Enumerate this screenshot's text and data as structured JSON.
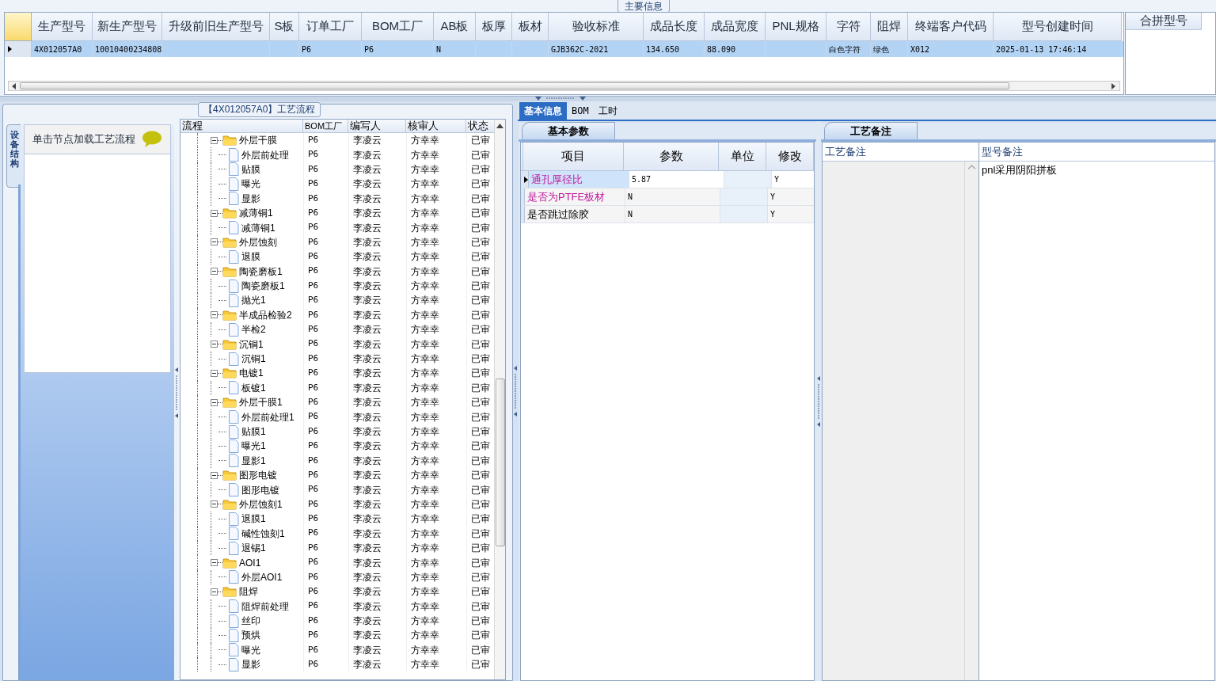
{
  "main_group": {
    "title": "主要信息"
  },
  "main_grid": {
    "columns": [
      "生产型号",
      "新生产型号",
      "升级前旧生产型号",
      "S板",
      "订单工厂",
      "BOM工厂",
      "AB板",
      "板厚",
      "板材",
      "验收标准",
      "成品长度",
      "成品宽度",
      "PNL规格",
      "字符",
      "阻焊",
      "终端客户代码",
      "型号创建时间"
    ],
    "rows": [
      {
        "selected": true,
        "cells": [
          "4X012057A0",
          "10010400234808",
          "",
          "",
          "P6",
          "P6",
          "N",
          "",
          "",
          "GJB362C-2021",
          "134.650",
          "88.090",
          "",
          "白色字符",
          "绿色",
          "X012",
          "2025-01-13 17:46:14"
        ]
      }
    ]
  },
  "merge_panel": {
    "column": "合拼型号"
  },
  "flow_group": {
    "title": "【4X012057A0】工艺流程"
  },
  "side_tabs": [
    {
      "label": "设备结构",
      "selected": true
    }
  ],
  "side_panel": {
    "hint": "单击节点加载工艺流程"
  },
  "flow_tree": {
    "columns": [
      "流程",
      "BOM工厂",
      "编写人",
      "核审人",
      "状态"
    ],
    "nodes": [
      {
        "label": "外层干膜",
        "bom": "P6",
        "writer": "李凌云",
        "reviewer": "方幸幸",
        "status": "已审",
        "expanded": true,
        "children": [
          {
            "label": "外层前处理",
            "bom": "P6",
            "writer": "李凌云",
            "reviewer": "方幸幸",
            "status": "已审"
          },
          {
            "label": "贴膜",
            "bom": "P6",
            "writer": "李凌云",
            "reviewer": "方幸幸",
            "status": "已审"
          },
          {
            "label": "曝光",
            "bom": "P6",
            "writer": "李凌云",
            "reviewer": "方幸幸",
            "status": "已审"
          },
          {
            "label": "显影",
            "bom": "P6",
            "writer": "李凌云",
            "reviewer": "方幸幸",
            "status": "已审"
          }
        ]
      },
      {
        "label": "减薄铜1",
        "bom": "P6",
        "writer": "李凌云",
        "reviewer": "方幸幸",
        "status": "已审",
        "expanded": true,
        "children": [
          {
            "label": "减薄铜1",
            "bom": "P6",
            "writer": "李凌云",
            "reviewer": "方幸幸",
            "status": "已审"
          }
        ]
      },
      {
        "label": "外层蚀刻",
        "bom": "P6",
        "writer": "李凌云",
        "reviewer": "方幸幸",
        "status": "已审",
        "expanded": true,
        "children": [
          {
            "label": "退膜",
            "bom": "P6",
            "writer": "李凌云",
            "reviewer": "方幸幸",
            "status": "已审"
          }
        ]
      },
      {
        "label": "陶瓷磨板1",
        "bom": "P6",
        "writer": "李凌云",
        "reviewer": "方幸幸",
        "status": "已审",
        "expanded": true,
        "children": [
          {
            "label": "陶瓷磨板1",
            "bom": "P6",
            "writer": "李凌云",
            "reviewer": "方幸幸",
            "status": "已审"
          },
          {
            "label": "抛光1",
            "bom": "P6",
            "writer": "李凌云",
            "reviewer": "方幸幸",
            "status": "已审"
          }
        ]
      },
      {
        "label": "半成品检验2",
        "bom": "P6",
        "writer": "李凌云",
        "reviewer": "方幸幸",
        "status": "已审",
        "expanded": true,
        "children": [
          {
            "label": "半检2",
            "bom": "P6",
            "writer": "李凌云",
            "reviewer": "方幸幸",
            "status": "已审"
          }
        ]
      },
      {
        "label": "沉铜1",
        "bom": "P6",
        "writer": "李凌云",
        "reviewer": "方幸幸",
        "status": "已审",
        "expanded": true,
        "children": [
          {
            "label": "沉铜1",
            "bom": "P6",
            "writer": "李凌云",
            "reviewer": "方幸幸",
            "status": "已审"
          }
        ]
      },
      {
        "label": "电镀1",
        "bom": "P6",
        "writer": "李凌云",
        "reviewer": "方幸幸",
        "status": "已审",
        "expanded": true,
        "children": [
          {
            "label": "板镀1",
            "bom": "P6",
            "writer": "李凌云",
            "reviewer": "方幸幸",
            "status": "已审"
          }
        ]
      },
      {
        "label": "外层干膜1",
        "bom": "P6",
        "writer": "李凌云",
        "reviewer": "方幸幸",
        "status": "已审",
        "expanded": true,
        "children": [
          {
            "label": "外层前处理1",
            "bom": "P6",
            "writer": "李凌云",
            "reviewer": "方幸幸",
            "status": "已审"
          },
          {
            "label": "贴膜1",
            "bom": "P6",
            "writer": "李凌云",
            "reviewer": "方幸幸",
            "status": "已审"
          },
          {
            "label": "曝光1",
            "bom": "P6",
            "writer": "李凌云",
            "reviewer": "方幸幸",
            "status": "已审"
          },
          {
            "label": "显影1",
            "bom": "P6",
            "writer": "李凌云",
            "reviewer": "方幸幸",
            "status": "已审"
          }
        ]
      },
      {
        "label": "图形电镀",
        "bom": "P6",
        "writer": "李凌云",
        "reviewer": "方幸幸",
        "status": "已审",
        "expanded": true,
        "children": [
          {
            "label": "图形电镀",
            "bom": "P6",
            "writer": "李凌云",
            "reviewer": "方幸幸",
            "status": "已审"
          }
        ]
      },
      {
        "label": "外层蚀刻1",
        "bom": "P6",
        "writer": "李凌云",
        "reviewer": "方幸幸",
        "status": "已审",
        "expanded": true,
        "children": [
          {
            "label": "退膜1",
            "bom": "P6",
            "writer": "李凌云",
            "reviewer": "方幸幸",
            "status": "已审"
          },
          {
            "label": "碱性蚀刻1",
            "bom": "P6",
            "writer": "李凌云",
            "reviewer": "方幸幸",
            "status": "已审"
          },
          {
            "label": "退锡1",
            "bom": "P6",
            "writer": "李凌云",
            "reviewer": "方幸幸",
            "status": "已审"
          }
        ]
      },
      {
        "label": "AOI1",
        "bom": "P6",
        "writer": "李凌云",
        "reviewer": "方幸幸",
        "status": "已审",
        "expanded": true,
        "children": [
          {
            "label": "外层AOI1",
            "bom": "P6",
            "writer": "李凌云",
            "reviewer": "方幸幸",
            "status": "已审"
          }
        ]
      },
      {
        "label": "阻焊",
        "bom": "P6",
        "writer": "李凌云",
        "reviewer": "方幸幸",
        "status": "已审",
        "expanded": true,
        "children": [
          {
            "label": "阻焊前处理",
            "bom": "P6",
            "writer": "李凌云",
            "reviewer": "方幸幸",
            "status": "已审"
          },
          {
            "label": "丝印",
            "bom": "P6",
            "writer": "李凌云",
            "reviewer": "方幸幸",
            "status": "已审"
          },
          {
            "label": "预烘",
            "bom": "P6",
            "writer": "李凌云",
            "reviewer": "方幸幸",
            "status": "已审"
          },
          {
            "label": "曝光",
            "bom": "P6",
            "writer": "李凌云",
            "reviewer": "方幸幸",
            "status": "已审"
          },
          {
            "label": "显影",
            "bom": "P6",
            "writer": "李凌云",
            "reviewer": "方幸幸",
            "status": "已审"
          }
        ]
      }
    ]
  },
  "detail_tabs": [
    {
      "label": "基本信息",
      "selected": true
    },
    {
      "label": "BOM",
      "selected": false
    },
    {
      "label": "工时",
      "selected": false
    }
  ],
  "params_panel": {
    "title": "基本参数",
    "columns": [
      "项目",
      "参数",
      "单位",
      "修改"
    ],
    "rows": [
      {
        "selected": true,
        "highlighted": true,
        "item": "通孔厚径比",
        "value": "5.87",
        "editable": "Y"
      },
      {
        "selected": false,
        "highlighted": true,
        "item": "是否为PTFE板材",
        "value": "N",
        "editable": "Y"
      },
      {
        "selected": false,
        "highlighted": false,
        "item": "是否跳过除胶",
        "value": "N",
        "editable": "Y"
      }
    ]
  },
  "notes_panel": {
    "title": "工艺备注",
    "columns": [
      "工艺备注",
      "型号备注"
    ],
    "model_note": "pnl采用阴阳拼板"
  }
}
